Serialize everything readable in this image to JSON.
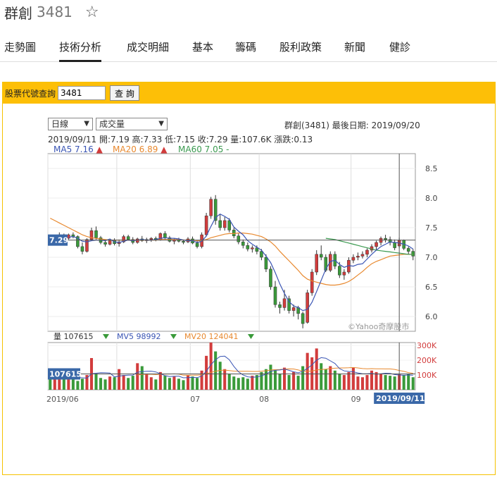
{
  "header": {
    "name": "群創",
    "code": "3481"
  },
  "tabs": [
    "走勢圖",
    "技術分析",
    "成交明細",
    "基本",
    "籌碼",
    "股利政策",
    "新聞",
    "健診"
  ],
  "query": {
    "label": "股票代號查詢",
    "value": "3481",
    "button": "查 詢"
  },
  "selectors": {
    "period": "日線",
    "indicator": "成交量"
  },
  "info": {
    "title": "群創(3481)   最後日期: 2019/09/20",
    "ohlc": "2019/09/11  開:7.19  高:7.33  低:7.15  收:7.29  量:107.6K  漲跌:0.13",
    "ma5": "MA5 7.16",
    "ma20": "MA20 6.89",
    "ma60": "MA60 7.05 -"
  },
  "volume_legend": {
    "vol": "量 107615",
    "mv5": "MV5 98992",
    "mv20": "MV20 124041"
  },
  "watermark": "©Yahoo奇摩股市",
  "cursor": {
    "price": "7.29",
    "volume": "107615",
    "date": "2019/09/11"
  },
  "colors": {
    "up": "#d23c3c",
    "down": "#3a9a3a",
    "ma5": "#3a55b4",
    "ma20": "#e8892f",
    "ma60": "#3b9a50",
    "accent": "#fdbf07"
  },
  "chart_data": {
    "type": "candlestick",
    "price_ticks": [
      "8.5",
      "8.0",
      "7.5",
      "7.0",
      "6.5",
      "6.0"
    ],
    "ylim": [
      5.75,
      8.75
    ],
    "vol_ticks": [
      "300K",
      "200K",
      "100K"
    ],
    "vol_ylim": [
      0,
      320000
    ],
    "x_labels": [
      "2019/06",
      "07",
      "08",
      "09"
    ],
    "candles": [
      [
        7.33,
        7.36,
        7.28,
        7.31
      ],
      [
        7.31,
        7.35,
        7.27,
        7.34
      ],
      [
        7.34,
        7.42,
        7.3,
        7.38
      ],
      [
        7.38,
        7.4,
        7.3,
        7.32
      ],
      [
        7.32,
        7.4,
        7.3,
        7.38
      ],
      [
        7.38,
        7.42,
        7.32,
        7.35
      ],
      [
        7.35,
        7.37,
        7.15,
        7.18
      ],
      [
        7.18,
        7.25,
        7.05,
        7.1
      ],
      [
        7.1,
        7.32,
        7.08,
        7.3
      ],
      [
        7.3,
        7.5,
        7.28,
        7.45
      ],
      [
        7.45,
        7.52,
        7.3,
        7.33
      ],
      [
        7.33,
        7.36,
        7.22,
        7.25
      ],
      [
        7.25,
        7.3,
        7.18,
        7.22
      ],
      [
        7.22,
        7.3,
        7.2,
        7.28
      ],
      [
        7.28,
        7.32,
        7.2,
        7.23
      ],
      [
        7.23,
        7.3,
        7.18,
        7.26
      ],
      [
        7.26,
        7.38,
        7.24,
        7.35
      ],
      [
        7.35,
        7.38,
        7.28,
        7.3
      ],
      [
        7.3,
        7.34,
        7.22,
        7.25
      ],
      [
        7.25,
        7.33,
        7.23,
        7.31
      ],
      [
        7.31,
        7.36,
        7.26,
        7.28
      ],
      [
        7.28,
        7.33,
        7.24,
        7.3
      ],
      [
        7.3,
        7.34,
        7.26,
        7.32
      ],
      [
        7.32,
        7.35,
        7.27,
        7.29
      ],
      [
        7.29,
        7.42,
        7.28,
        7.4
      ],
      [
        7.4,
        7.44,
        7.3,
        7.33
      ],
      [
        7.33,
        7.36,
        7.25,
        7.27
      ],
      [
        7.27,
        7.32,
        7.22,
        7.3
      ],
      [
        7.3,
        7.33,
        7.25,
        7.27
      ],
      [
        7.27,
        7.3,
        7.22,
        7.26
      ],
      [
        7.26,
        7.34,
        7.24,
        7.31
      ],
      [
        7.31,
        7.35,
        7.22,
        7.24
      ],
      [
        7.24,
        7.28,
        7.15,
        7.18
      ],
      [
        7.18,
        7.42,
        7.15,
        7.38
      ],
      [
        7.38,
        7.75,
        7.35,
        7.7
      ],
      [
        7.7,
        8.02,
        7.65,
        7.98
      ],
      [
        7.98,
        8.05,
        7.55,
        7.62
      ],
      [
        7.62,
        7.72,
        7.45,
        7.5
      ],
      [
        7.5,
        7.68,
        7.45,
        7.62
      ],
      [
        7.62,
        7.66,
        7.42,
        7.46
      ],
      [
        7.46,
        7.5,
        7.32,
        7.36
      ],
      [
        7.36,
        7.4,
        7.22,
        7.26
      ],
      [
        7.26,
        7.3,
        7.15,
        7.2
      ],
      [
        7.2,
        7.25,
        7.1,
        7.14
      ],
      [
        7.14,
        7.2,
        7.08,
        7.16
      ],
      [
        7.16,
        7.2,
        7.05,
        7.1
      ],
      [
        7.1,
        7.14,
        6.95,
        7.0
      ],
      [
        7.0,
        7.05,
        6.75,
        6.8
      ],
      [
        6.8,
        6.85,
        6.45,
        6.5
      ],
      [
        6.5,
        6.6,
        6.15,
        6.2
      ],
      [
        6.2,
        6.25,
        6.05,
        6.15
      ],
      [
        6.15,
        6.45,
        6.1,
        6.3
      ],
      [
        6.3,
        6.35,
        6.05,
        6.1
      ],
      [
        6.1,
        6.2,
        6.0,
        6.15
      ],
      [
        6.15,
        6.18,
        5.95,
        6.05
      ],
      [
        6.05,
        6.08,
        5.8,
        5.88
      ],
      [
        5.9,
        6.45,
        5.88,
        6.4
      ],
      [
        6.4,
        6.8,
        6.35,
        6.75
      ],
      [
        6.75,
        7.12,
        6.7,
        7.05
      ],
      [
        7.05,
        7.2,
        6.95,
        7.0
      ],
      [
        7.0,
        7.05,
        6.75,
        6.78
      ],
      [
        6.78,
        7.1,
        6.75,
        7.05
      ],
      [
        7.05,
        7.1,
        6.8,
        6.85
      ],
      [
        6.85,
        6.92,
        6.65,
        6.7
      ],
      [
        6.7,
        6.8,
        6.62,
        6.75
      ],
      [
        6.75,
        7.0,
        6.72,
        6.95
      ],
      [
        6.95,
        7.05,
        6.9,
        7.0
      ],
      [
        7.0,
        7.08,
        6.95,
        7.02
      ],
      [
        7.02,
        7.1,
        6.98,
        7.05
      ],
      [
        7.05,
        7.15,
        7.0,
        7.12
      ],
      [
        7.12,
        7.22,
        7.08,
        7.18
      ],
      [
        7.18,
        7.28,
        7.12,
        7.25
      ],
      [
        7.25,
        7.35,
        7.2,
        7.32
      ],
      [
        7.32,
        7.38,
        7.25,
        7.3
      ],
      [
        7.3,
        7.35,
        7.2,
        7.25
      ],
      [
        7.25,
        7.3,
        7.12,
        7.16
      ],
      [
        7.19,
        7.33,
        7.15,
        7.29
      ],
      [
        7.29,
        7.3,
        7.12,
        7.15
      ],
      [
        7.15,
        7.18,
        7.05,
        7.1
      ],
      [
        7.1,
        7.14,
        6.95,
        7.02
      ]
    ],
    "volumes": [
      80000,
      95000,
      85000,
      110000,
      70000,
      90000,
      60000,
      75000,
      100000,
      215000,
      110000,
      80000,
      70000,
      90000,
      85000,
      140000,
      100000,
      80000,
      95000,
      180000,
      160000,
      110000,
      85000,
      70000,
      120000,
      95000,
      80000,
      90000,
      75000,
      65000,
      100000,
      90000,
      80000,
      130000,
      230000,
      320000,
      260000,
      190000,
      140000,
      110000,
      90000,
      80000,
      85000,
      75000,
      95000,
      100000,
      120000,
      140000,
      170000,
      130000,
      110000,
      150000,
      100000,
      120000,
      95000,
      160000,
      250000,
      220000,
      280000,
      180000,
      140000,
      160000,
      130000,
      110000,
      100000,
      120000,
      150000,
      90000,
      85000,
      100000,
      130000,
      120000,
      110000,
      100000,
      95000,
      90000,
      107615,
      100000,
      110000,
      85000
    ],
    "ma5": [
      null,
      null,
      null,
      null,
      7.34,
      7.35,
      7.32,
      7.27,
      7.26,
      7.28,
      7.29,
      7.29,
      7.28,
      7.31,
      7.26,
      7.25,
      7.27,
      7.29,
      7.28,
      7.29,
      7.3,
      7.29,
      7.29,
      7.3,
      7.32,
      7.33,
      7.32,
      7.32,
      7.31,
      7.29,
      7.28,
      7.28,
      7.25,
      7.27,
      7.36,
      7.52,
      7.67,
      7.73,
      7.69,
      7.64,
      7.51,
      7.44,
      7.38,
      7.28,
      7.22,
      7.17,
      7.12,
      7.02,
      6.91,
      6.74,
      6.55,
      6.39,
      6.25,
      6.18,
      6.15,
      6.1,
      6.12,
      6.24,
      6.42,
      6.61,
      6.8,
      6.93,
      6.95,
      6.88,
      6.83,
      6.86,
      6.85,
      6.88,
      6.89,
      6.97,
      7.05,
      7.12,
      7.18,
      7.22,
      7.26,
      7.25,
      7.24,
      7.22,
      7.19,
      7.14
    ],
    "ma20": [
      7.66,
      7.62,
      7.58,
      7.54,
      7.5,
      7.46,
      7.42,
      7.38,
      7.35,
      7.33,
      7.32,
      7.31,
      7.3,
      7.29,
      7.29,
      7.29,
      7.29,
      7.29,
      7.29,
      7.29,
      7.29,
      7.29,
      7.29,
      7.29,
      7.3,
      7.3,
      7.3,
      7.3,
      7.3,
      7.29,
      7.29,
      7.29,
      7.28,
      7.28,
      7.3,
      7.33,
      7.35,
      7.37,
      7.39,
      7.4,
      7.4,
      7.41,
      7.41,
      7.4,
      7.39,
      7.37,
      7.35,
      7.31,
      7.26,
      7.19,
      7.1,
      7.02,
      6.94,
      6.86,
      6.78,
      6.69,
      6.63,
      6.6,
      6.58,
      6.56,
      6.54,
      6.53,
      6.53,
      6.54,
      6.56,
      6.59,
      6.64,
      6.7,
      6.76,
      6.83,
      6.89,
      6.93,
      6.96,
      6.99,
      7.02,
      7.03,
      7.04,
      7.05,
      7.05,
      7.05
    ],
    "ma60": [
      null,
      null,
      null,
      null,
      null,
      null,
      null,
      null,
      null,
      null,
      null,
      null,
      null,
      null,
      null,
      null,
      null,
      null,
      null,
      null,
      null,
      null,
      null,
      null,
      null,
      null,
      null,
      null,
      null,
      null,
      null,
      null,
      null,
      null,
      null,
      null,
      null,
      null,
      null,
      null,
      null,
      null,
      null,
      null,
      null,
      null,
      null,
      null,
      null,
      null,
      null,
      null,
      null,
      null,
      null,
      null,
      null,
      null,
      null,
      null,
      7.32,
      7.31,
      7.3,
      7.28,
      7.26,
      7.24,
      7.22,
      7.2,
      7.18,
      7.16,
      7.14,
      7.12,
      7.11,
      7.1,
      7.09,
      7.08,
      7.07,
      7.06,
      7.05,
      7.05
    ]
  }
}
